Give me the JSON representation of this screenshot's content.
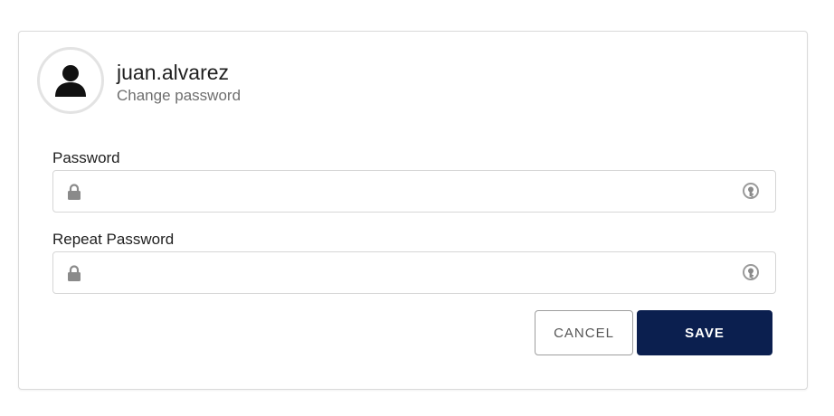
{
  "profile": {
    "username": "juan.alvarez",
    "subtitle": "Change password",
    "avatar_icon": "user-silhouette-icon"
  },
  "form": {
    "password": {
      "label": "Password",
      "value": "",
      "leading_icon": "lock-icon",
      "trailing_icon": "reveal-password-icon"
    },
    "repeat_password": {
      "label": "Repeat Password",
      "value": "",
      "leading_icon": "lock-icon",
      "trailing_icon": "reveal-password-icon"
    }
  },
  "actions": {
    "cancel_label": "CANCEL",
    "save_label": "SAVE"
  },
  "colors": {
    "primary": "#0b1f4f",
    "border": "#d6d6d6",
    "icon_gray": "#8a8a8a",
    "text_dark": "#1f1f1f",
    "text_muted": "#6e6e6e"
  }
}
